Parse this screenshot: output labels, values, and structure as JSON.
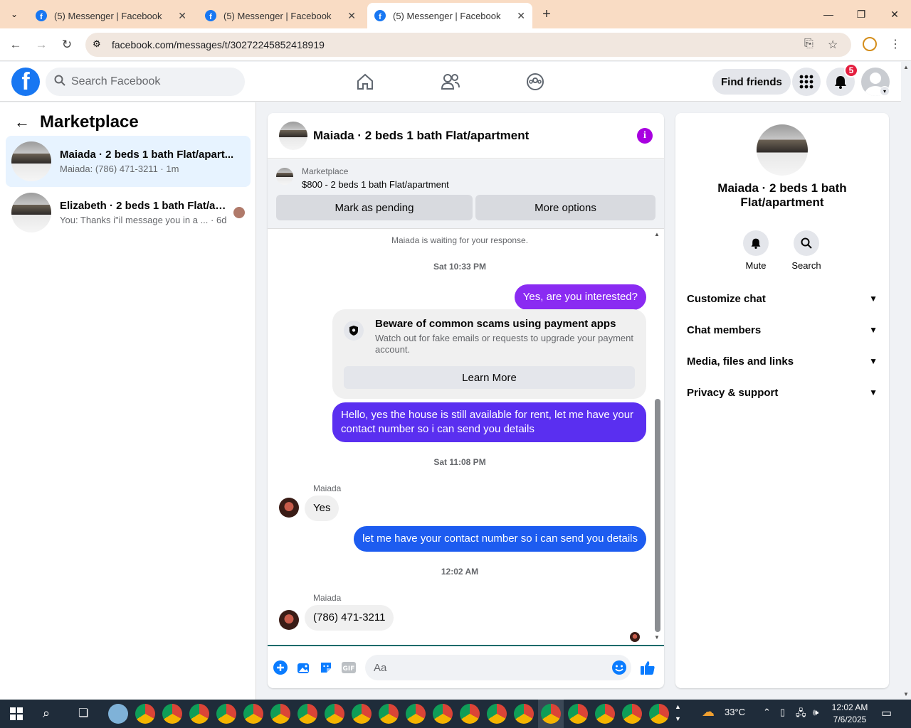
{
  "browser": {
    "tabs": [
      {
        "title": "(5) Messenger | Facebook"
      },
      {
        "title": "(5) Messenger | Facebook"
      },
      {
        "title": "(5) Messenger | Facebook"
      }
    ],
    "url": "facebook.com/messages/t/30272245852418919"
  },
  "fb_header": {
    "search_placeholder": "Search Facebook",
    "find_friends_label": "Find friends",
    "notification_count": "5"
  },
  "sidebar": {
    "title": "Marketplace",
    "conversations": [
      {
        "title": "Maiada · 2 beds 1 bath Flat/apart...",
        "preview": "Maiada: (786) 471-3211 · 1m"
      },
      {
        "title": "Elizabeth · 2 beds 1 bath Flat/ap...",
        "preview": "You: Thanks i\"il message you in a ...",
        "time": "· 6d"
      }
    ]
  },
  "chat": {
    "title": "Maiada · 2 beds 1 bath Flat/apartment",
    "marketplace_label": "Marketplace",
    "listing": "$800 - 2 beds 1 bath Flat/apartment",
    "mark_pending_label": "Mark as pending",
    "more_options_label": "More options",
    "waiting_text": "Maiada is waiting for your response.",
    "timestamp_1": "Sat 10:33 PM",
    "msg_1": "Yes, are you interested?",
    "warning_title": "Beware of common scams using payment apps",
    "warning_body": "Watch out for fake emails or requests to upgrade your payment account.",
    "learn_more_label": "Learn More",
    "msg_2": "Hello, yes the house is still available for rent, let me have your contact number so i can send you details",
    "timestamp_2": "Sat 11:08 PM",
    "sender_1": "Maiada",
    "msg_3": "Yes",
    "msg_4": "let me have your contact number so i can send you details",
    "timestamp_3": "12:02 AM",
    "sender_2": "Maiada",
    "msg_5": "(786) 471-3211",
    "input_placeholder": "Aa",
    "colors": {
      "outgoing_purple": "#8a2bf2",
      "outgoing_violet": "#5a2ff0",
      "outgoing_blue": "#1d5cf0"
    }
  },
  "info_panel": {
    "title": "Maiada · 2 beds 1 bath Flat/apartment",
    "mute_label": "Mute",
    "search_label": "Search",
    "sections": [
      {
        "label": "Customize chat"
      },
      {
        "label": "Chat members"
      },
      {
        "label": "Media, files and links"
      },
      {
        "label": "Privacy & support"
      }
    ]
  },
  "taskbar": {
    "weather": "33°C",
    "time": "12:02 AM",
    "date": "7/6/2025"
  }
}
